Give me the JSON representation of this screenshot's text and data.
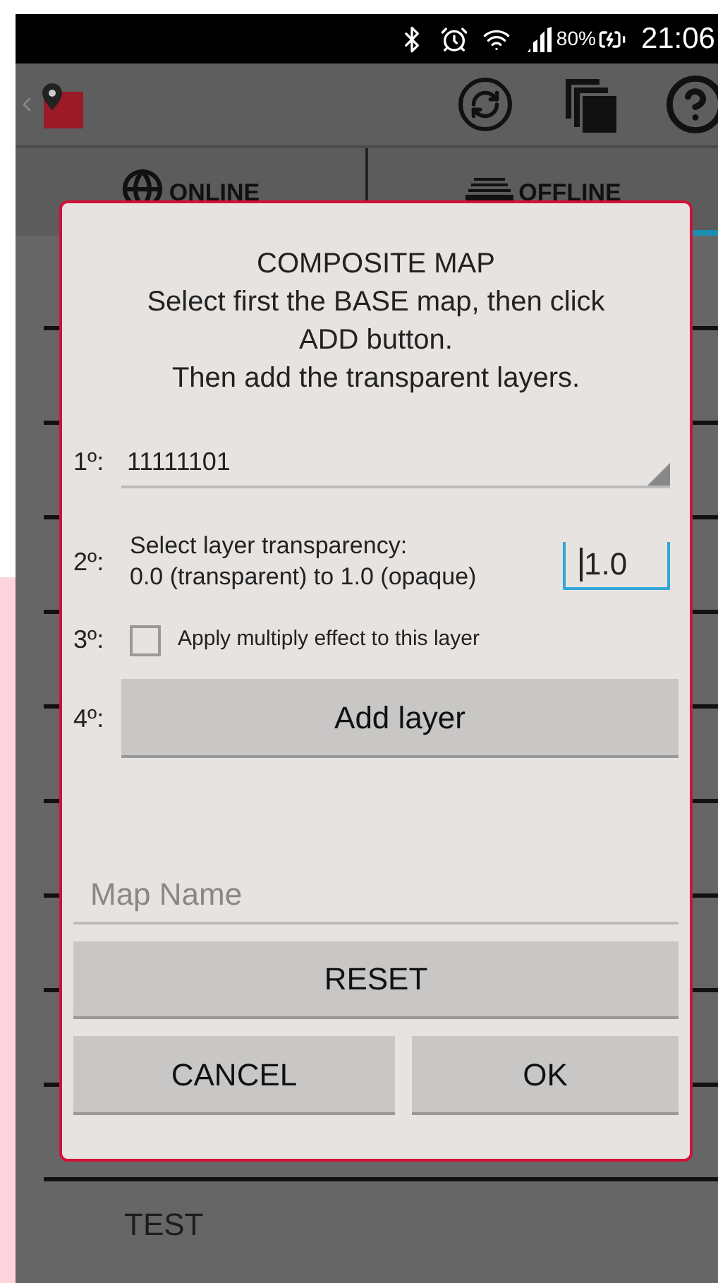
{
  "status_bar": {
    "battery": "80%",
    "time": "21:06"
  },
  "tabs": [
    {
      "label": "ONLINE",
      "selected": false
    },
    {
      "label": "OFFLINE",
      "selected": true
    }
  ],
  "list": {
    "rows": [
      {
        "label": "TEST"
      }
    ]
  },
  "dialog": {
    "title": "COMPOSITE MAP",
    "instructions": [
      "Select first the BASE map, then click ADD button.",
      "Then add the transparent layers."
    ],
    "base_map": {
      "step": "1º:",
      "value": "11111101"
    },
    "transparency": {
      "step": "2º:",
      "label": "Select layer transparency:",
      "hint": "0.0 (transparent) to 1.0 (opaque)",
      "value": "1.0"
    },
    "multiply": {
      "step": "3º:",
      "label": "Apply multiply effect to this layer",
      "checked": false
    },
    "add": {
      "step": "4º:",
      "button": "Add layer"
    },
    "map_name": {
      "placeholder": "Map Name"
    },
    "reset_button": "RESET",
    "cancel_button": "CANCEL",
    "ok_button": "OK"
  }
}
